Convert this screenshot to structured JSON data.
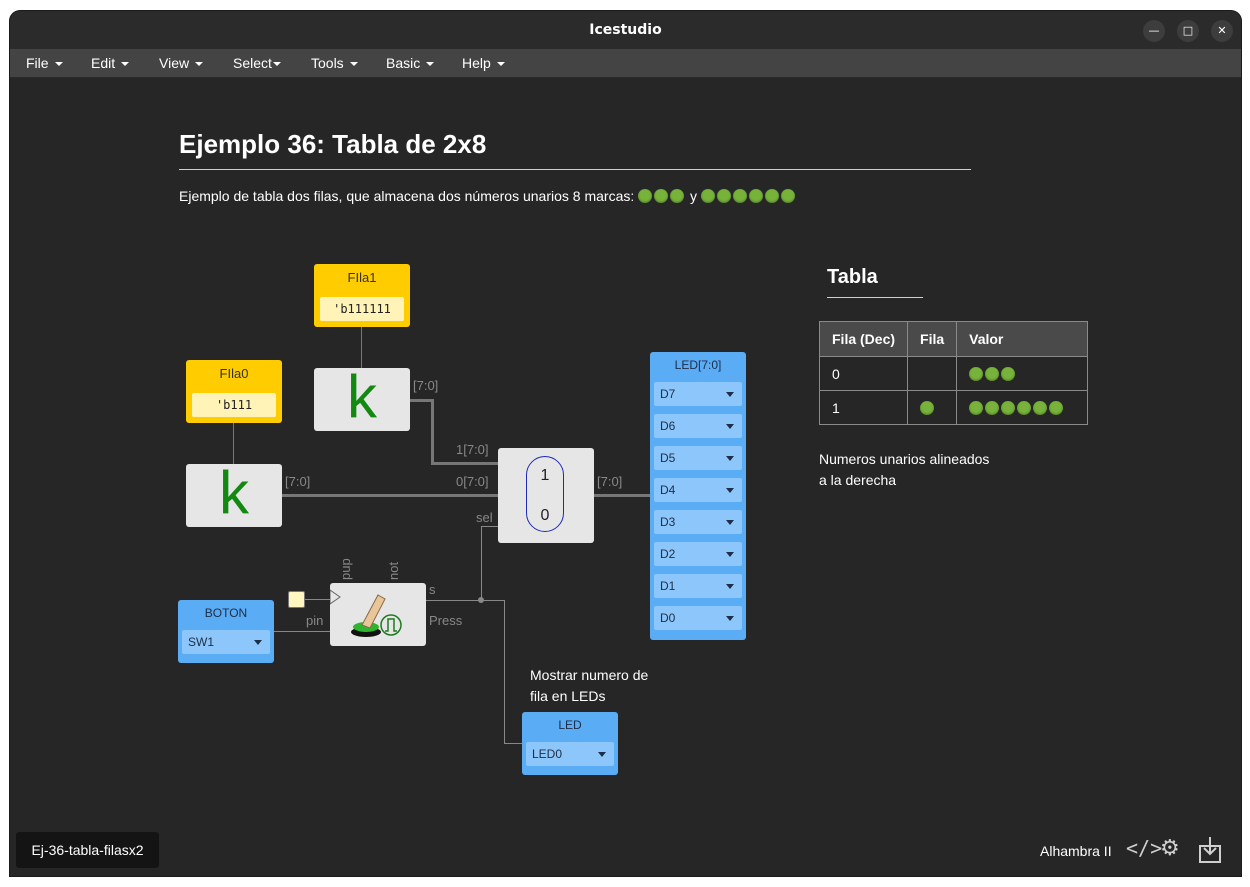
{
  "window": {
    "title": "Icestudio"
  },
  "menu": [
    "File",
    "Edit",
    "View",
    "Select",
    "Tools",
    "Basic",
    "Help"
  ],
  "menu_carets": [
    true,
    true,
    true,
    true,
    true,
    true,
    true
  ],
  "doc": {
    "heading": "Ejemplo 36: Tabla de 2x8",
    "description": "Ejemplo de tabla dos filas, que almacena dos números unarios 8 marcas:",
    "desc_join": "y",
    "desc_groups": [
      3,
      6
    ]
  },
  "blocks": {
    "fila1": {
      "label": "FIla1",
      "value": "'b111111"
    },
    "fila0": {
      "label": "FIla0",
      "value": "'b111"
    },
    "k_glyph": "k",
    "mux": {
      "in1": "1",
      "in0": "0"
    },
    "boton": {
      "label": "BOTON",
      "select": "SW1"
    },
    "led": {
      "label": "LED",
      "select": "LED0"
    },
    "leds": {
      "label": "LED[7:0]",
      "items": [
        "D7",
        "D6",
        "D5",
        "D4",
        "D3",
        "D2",
        "D1",
        "D0"
      ]
    }
  },
  "wires": {
    "k1_out": "[7:0]",
    "k0_out": "[7:0]",
    "mux_in1": "1[7:0]",
    "mux_in0": "0[7:0]",
    "mux_out": "[7:0]",
    "sel": "sel",
    "pup": "pup",
    "not": "not",
    "s": "s",
    "pin": "pin",
    "press": "Press"
  },
  "comment_leds": {
    "line1": "Mostrar numero de",
    "line2": "fila en LEDs"
  },
  "table_section": {
    "title": "Tabla",
    "headers": [
      "Fila (Dec)",
      "Fila",
      "Valor"
    ],
    "rows": [
      {
        "dec": "0",
        "fila_marks": 0,
        "valor_marks": 3
      },
      {
        "dec": "1",
        "fila_marks": 1,
        "valor_marks": 6
      }
    ],
    "note_line1": "Numeros unarios alineados",
    "note_line2": "a la derecha"
  },
  "status": {
    "tab": "Ej-36-tabla-filasx2",
    "board": "Alhambra II"
  },
  "colors": {
    "accent_blue": "#5aacf5",
    "const_yellow": "#ffcc00",
    "mark_green": "#77b33b",
    "k_green": "#128a12"
  }
}
